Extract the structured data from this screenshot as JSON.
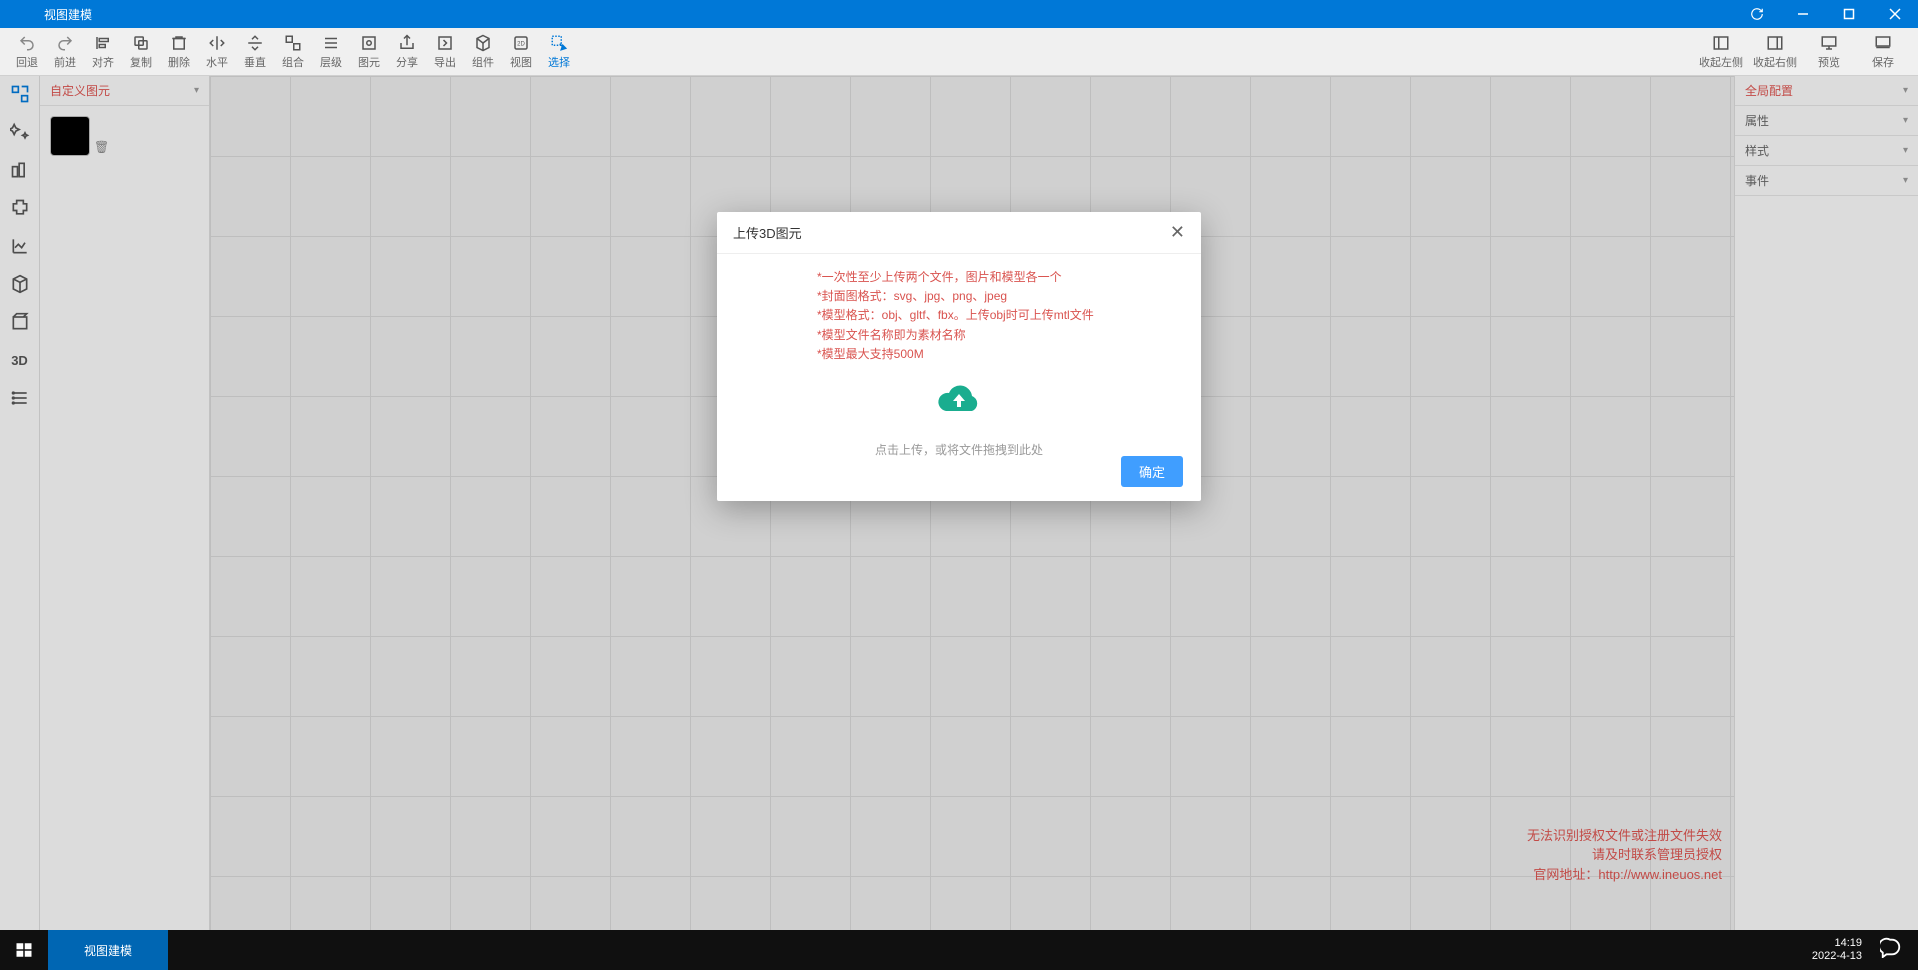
{
  "window": {
    "title": "视图建模"
  },
  "toolbar": [
    {
      "id": "undo",
      "label": "回退"
    },
    {
      "id": "redo",
      "label": "前进"
    },
    {
      "id": "align",
      "label": "对齐"
    },
    {
      "id": "copy",
      "label": "复制"
    },
    {
      "id": "delete",
      "label": "删除"
    },
    {
      "id": "horiz",
      "label": "水平"
    },
    {
      "id": "vert",
      "label": "垂直"
    },
    {
      "id": "group",
      "label": "组合"
    },
    {
      "id": "layer",
      "label": "层级"
    },
    {
      "id": "element",
      "label": "图元"
    },
    {
      "id": "share",
      "label": "分享"
    },
    {
      "id": "export",
      "label": "导出"
    },
    {
      "id": "component",
      "label": "组件"
    },
    {
      "id": "view",
      "label": "视图"
    },
    {
      "id": "select",
      "label": "选择",
      "active": true
    }
  ],
  "toolbar_right": [
    {
      "id": "hide-left",
      "label": "收起左侧"
    },
    {
      "id": "hide-right",
      "label": "收起右侧"
    },
    {
      "id": "preview",
      "label": "预览"
    },
    {
      "id": "save",
      "label": "保存"
    }
  ],
  "left_panel": {
    "section_title": "自定义图元"
  },
  "right_panel": {
    "items": [
      "全局配置",
      "属性",
      "样式",
      "事件"
    ]
  },
  "dialog": {
    "title": "上传3D图元",
    "rules": [
      "*一次性至少上传两个文件，图片和模型各一个",
      "*封面图格式：svg、jpg、png、jpeg",
      "*模型格式：obj、gltf、fbx。上传obj时可上传mtl文件",
      "*模型文件名称即为素材名称",
      "*模型最大支持500M"
    ],
    "upload_hint": "点击上传，或将文件拖拽到此处",
    "ok_label": "确定"
  },
  "license_warning": {
    "line1": "无法识别授权文件或注册文件失效",
    "line2": "请及时联系管理员授权",
    "line3_prefix": "官网地址：",
    "url": "http://www.ineuos.net"
  },
  "taskbar": {
    "app": "视图建模",
    "time": "14:19",
    "date": "2022-4-13"
  }
}
